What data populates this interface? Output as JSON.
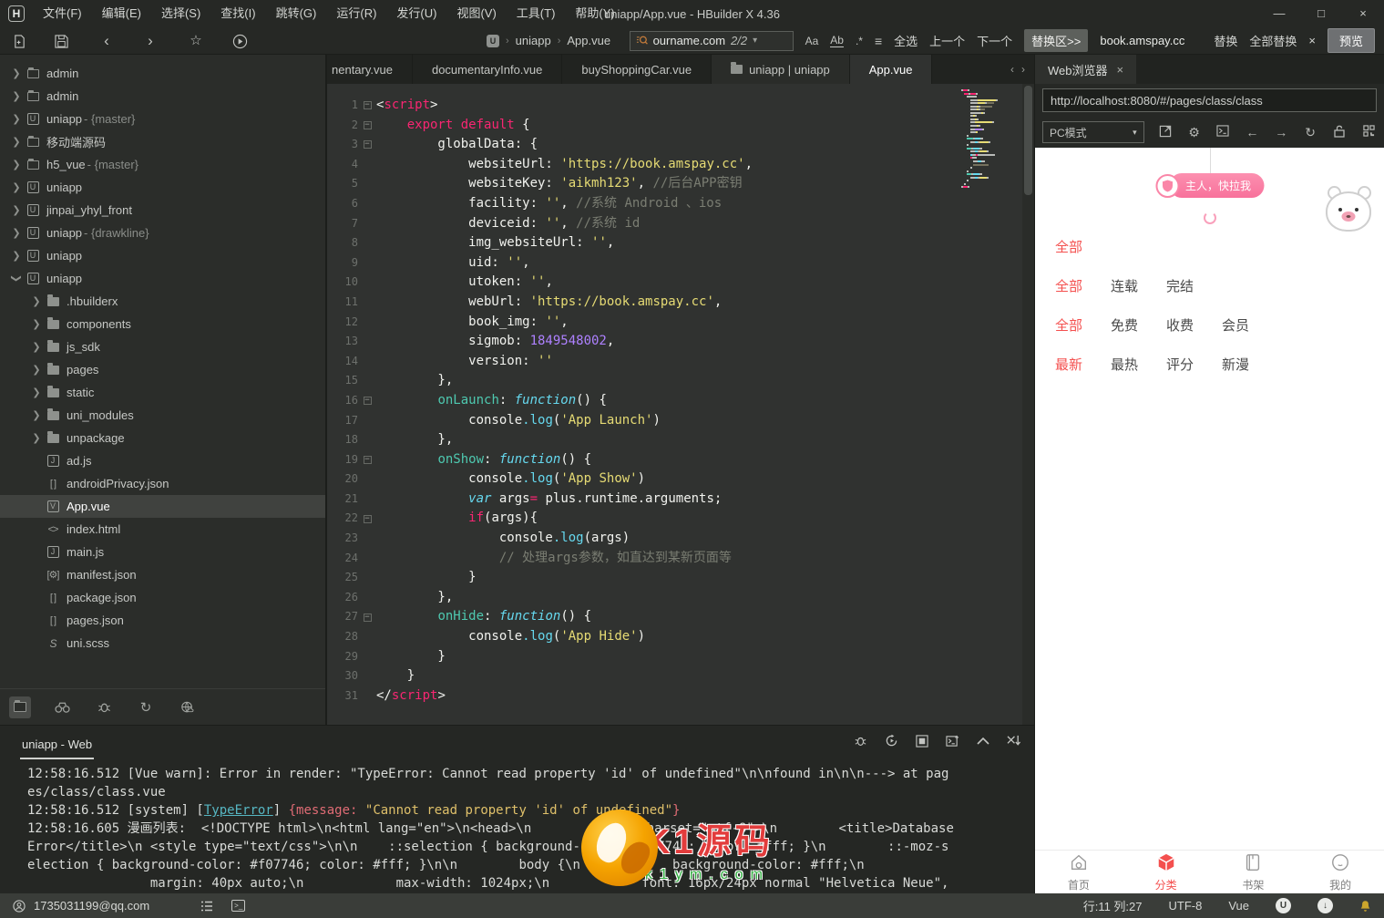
{
  "window": {
    "title": "uniapp/App.vue - HBuilder X 4.36",
    "logo": "H",
    "minimize": "—",
    "maximize": "□",
    "close": "×"
  },
  "menus": [
    "文件(F)",
    "编辑(E)",
    "选择(S)",
    "查找(I)",
    "跳转(G)",
    "运行(R)",
    "发行(U)",
    "视图(V)",
    "工具(T)",
    "帮助(Y)"
  ],
  "toolbar": {
    "crumb_project": "uniapp",
    "crumb_file": "App.vue",
    "search_value": "ourname.com",
    "search_count": "2/2",
    "match_case": "Aa",
    "whole_word": "Ab",
    "regex": ".*",
    "filter_lines": "≡",
    "select_all": "全选",
    "prev": "上一个",
    "next": "下一个",
    "replace_zone": "替换区>>",
    "replace_value": "book.amspay.cc",
    "replace": "替换",
    "replace_all": "全部替换",
    "close": "×",
    "preview": "预览"
  },
  "colors": {
    "accent_pink": "#fa86a8",
    "hot_red": "#f4504f",
    "keyword": "#f92672",
    "string": "#e6db74",
    "number": "#ae81ff",
    "function": "#66d9ef",
    "lifecycle": "#4ec9b0",
    "comment": "#7a7d72",
    "error_link": "#56b6c2",
    "bell_yellow": "#cda62c"
  },
  "sidebar": {
    "items": [
      {
        "arrow": ">",
        "icon": "folder",
        "label": "admin",
        "depth": 0
      },
      {
        "arrow": ">",
        "icon": "folder",
        "label": "admin",
        "depth": 0
      },
      {
        "arrow": ">",
        "icon": "proj",
        "label": "uniapp",
        "suffix": " - {master}",
        "depth": 0
      },
      {
        "arrow": ">",
        "icon": "folder",
        "label": "移动端源码",
        "depth": 0
      },
      {
        "arrow": ">",
        "icon": "folder",
        "label": "h5_vue",
        "suffix": " - {master}",
        "depth": 0
      },
      {
        "arrow": ">",
        "icon": "proj",
        "label": "uniapp",
        "depth": 0
      },
      {
        "arrow": ">",
        "icon": "proj",
        "label": "jinpai_yhyl_front",
        "depth": 0
      },
      {
        "arrow": ">",
        "icon": "proj",
        "label": "uniapp",
        "suffix": " - {drawkline}",
        "depth": 0
      },
      {
        "arrow": ">",
        "icon": "proj",
        "label": "uniapp",
        "depth": 0
      },
      {
        "arrow": "v",
        "icon": "proj",
        "label": "uniapp",
        "depth": 0
      },
      {
        "arrow": ">",
        "icon": "folder2",
        "label": ".hbuilderx",
        "depth": 1
      },
      {
        "arrow": ">",
        "icon": "folder2",
        "label": "components",
        "depth": 1
      },
      {
        "arrow": ">",
        "icon": "folder2",
        "label": "js_sdk",
        "depth": 1
      },
      {
        "arrow": ">",
        "icon": "folder2",
        "label": "pages",
        "depth": 1
      },
      {
        "arrow": ">",
        "icon": "folder2",
        "label": "static",
        "depth": 1
      },
      {
        "arrow": ">",
        "icon": "folder2",
        "label": "uni_modules",
        "depth": 1
      },
      {
        "arrow": ">",
        "icon": "folder2",
        "label": "unpackage",
        "depth": 1
      },
      {
        "icon": "js",
        "label": "ad.js",
        "depth": 1
      },
      {
        "icon": "json",
        "label": "androidPrivacy.json",
        "depth": 1
      },
      {
        "icon": "vue",
        "label": "App.vue",
        "depth": 1,
        "selected": true
      },
      {
        "icon": "html",
        "label": "index.html",
        "depth": 1
      },
      {
        "icon": "js",
        "label": "main.js",
        "depth": 1
      },
      {
        "icon": "manifest",
        "label": "manifest.json",
        "depth": 1
      },
      {
        "icon": "json",
        "label": "package.json",
        "depth": 1
      },
      {
        "icon": "json",
        "label": "pages.json",
        "depth": 1
      },
      {
        "icon": "scss",
        "label": "uni.scss",
        "depth": 1
      }
    ]
  },
  "editor": {
    "tabs": [
      {
        "label": "nentary.vue",
        "first": true
      },
      {
        "label": "documentaryInfo.vue"
      },
      {
        "label": "buyShoppingCar.vue"
      },
      {
        "label": "uniapp | uniapp",
        "icon": "folder",
        "mid": true
      },
      {
        "label": "App.vue",
        "active": true
      }
    ],
    "lines": [
      {
        "n": 1,
        "fold": 1,
        "tok": [
          [
            "pl",
            "<"
          ],
          [
            "kw",
            "script"
          ],
          [
            "pl",
            ">"
          ]
        ]
      },
      {
        "n": 2,
        "fold": 1,
        "tok": [
          [
            "pl",
            "    "
          ],
          [
            "kw",
            "export"
          ],
          [
            "pl",
            " "
          ],
          [
            "kw",
            "default"
          ],
          [
            "pl",
            " {"
          ]
        ]
      },
      {
        "n": 3,
        "fold": 1,
        "tok": [
          [
            "pl",
            "        globalData: {"
          ]
        ]
      },
      {
        "n": 4,
        "tok": [
          [
            "pl",
            "            websiteUrl: "
          ],
          [
            "str",
            "'https://book.amspay.cc'"
          ],
          [
            "pl",
            ","
          ]
        ]
      },
      {
        "n": 5,
        "tok": [
          [
            "pl",
            "            websiteKey: "
          ],
          [
            "str",
            "'aikmh123'"
          ],
          [
            "pl",
            ", "
          ],
          [
            "cmt",
            "//后台APP密钥"
          ]
        ]
      },
      {
        "n": 6,
        "tok": [
          [
            "pl",
            "            facility: "
          ],
          [
            "str",
            "''"
          ],
          [
            "pl",
            ", "
          ],
          [
            "cmt",
            "//系统 Android 、ios"
          ]
        ]
      },
      {
        "n": 7,
        "tok": [
          [
            "pl",
            "            deviceid: "
          ],
          [
            "str",
            "''"
          ],
          [
            "pl",
            ", "
          ],
          [
            "cmt",
            "//系统 id"
          ]
        ]
      },
      {
        "n": 8,
        "tok": [
          [
            "pl",
            "            img_websiteUrl: "
          ],
          [
            "str",
            "''"
          ],
          [
            "pl",
            ","
          ]
        ]
      },
      {
        "n": 9,
        "tok": [
          [
            "pl",
            "            uid: "
          ],
          [
            "str",
            "''"
          ],
          [
            "pl",
            ","
          ]
        ]
      },
      {
        "n": 10,
        "tok": [
          [
            "pl",
            "            utoken: "
          ],
          [
            "str",
            "''"
          ],
          [
            "pl",
            ","
          ]
        ]
      },
      {
        "n": 11,
        "tok": [
          [
            "pl",
            "            webUrl: "
          ],
          [
            "str",
            "'https://book.amspay.cc'"
          ],
          [
            "pl",
            ","
          ]
        ]
      },
      {
        "n": 12,
        "tok": [
          [
            "pl",
            "            book_img: "
          ],
          [
            "str",
            "''"
          ],
          [
            "pl",
            ","
          ]
        ]
      },
      {
        "n": 13,
        "tok": [
          [
            "pl",
            "            sigmob: "
          ],
          [
            "num",
            "1849548002"
          ],
          [
            "pl",
            ","
          ]
        ]
      },
      {
        "n": 14,
        "tok": [
          [
            "pl",
            "            version: "
          ],
          [
            "str",
            "''"
          ]
        ]
      },
      {
        "n": 15,
        "tok": [
          [
            "pl",
            "        },"
          ]
        ]
      },
      {
        "n": 16,
        "fold": 1,
        "tok": [
          [
            "pl",
            "        "
          ],
          [
            "name",
            "onLaunch"
          ],
          [
            "pl",
            ": "
          ],
          [
            "fn",
            "function"
          ],
          [
            "pl",
            "() {"
          ]
        ]
      },
      {
        "n": 17,
        "tok": [
          [
            "pl",
            "            console"
          ],
          [
            "meth",
            ".log"
          ],
          [
            "pl",
            "("
          ],
          [
            "str",
            "'App Launch'"
          ],
          [
            "pl",
            ")"
          ]
        ]
      },
      {
        "n": 18,
        "tok": [
          [
            "pl",
            "        },"
          ]
        ]
      },
      {
        "n": 19,
        "fold": 1,
        "tok": [
          [
            "pl",
            "        "
          ],
          [
            "name",
            "onShow"
          ],
          [
            "pl",
            ": "
          ],
          [
            "fn",
            "function"
          ],
          [
            "pl",
            "() {"
          ]
        ]
      },
      {
        "n": 20,
        "tok": [
          [
            "pl",
            "            console"
          ],
          [
            "meth",
            ".log"
          ],
          [
            "pl",
            "("
          ],
          [
            "str",
            "'App Show'"
          ],
          [
            "pl",
            ")"
          ]
        ]
      },
      {
        "n": 21,
        "tok": [
          [
            "pl",
            "            "
          ],
          [
            "fn",
            "var"
          ],
          [
            "pl",
            " args"
          ],
          [
            "kw",
            "="
          ],
          [
            "pl",
            " plus.runtime.arguments;"
          ]
        ]
      },
      {
        "n": 22,
        "fold": 1,
        "tok": [
          [
            "pl",
            "            "
          ],
          [
            "kw",
            "if"
          ],
          [
            "pl",
            "(args){"
          ]
        ]
      },
      {
        "n": 23,
        "tok": [
          [
            "pl",
            "                console"
          ],
          [
            "meth",
            ".log"
          ],
          [
            "pl",
            "(args)"
          ]
        ]
      },
      {
        "n": 24,
        "tok": [
          [
            "pl",
            "                "
          ],
          [
            "cmt",
            "// 处理args参数，如直达到某新页面等"
          ]
        ]
      },
      {
        "n": 25,
        "tok": [
          [
            "pl",
            "            }"
          ]
        ]
      },
      {
        "n": 26,
        "tok": [
          [
            "pl",
            "        },"
          ]
        ]
      },
      {
        "n": 27,
        "fold": 1,
        "tok": [
          [
            "pl",
            "        "
          ],
          [
            "name",
            "onHide"
          ],
          [
            "pl",
            ": "
          ],
          [
            "fn",
            "function"
          ],
          [
            "pl",
            "() {"
          ]
        ]
      },
      {
        "n": 28,
        "tok": [
          [
            "pl",
            "            console"
          ],
          [
            "meth",
            ".log"
          ],
          [
            "pl",
            "("
          ],
          [
            "str",
            "'App Hide'"
          ],
          [
            "pl",
            ")"
          ]
        ]
      },
      {
        "n": 29,
        "tok": [
          [
            "pl",
            "        }"
          ]
        ]
      },
      {
        "n": 30,
        "tok": [
          [
            "pl",
            "    }"
          ]
        ]
      },
      {
        "n": 31,
        "tok": [
          [
            "pl",
            "</"
          ],
          [
            "kw",
            "script"
          ],
          [
            "pl",
            ">"
          ]
        ]
      }
    ]
  },
  "browser": {
    "tab_label": "Web浏览器",
    "close": "×",
    "url": "http://localhost:8080/#/pages/class/class",
    "mode": "PC模式",
    "banner": "主人，快拉我",
    "filters": [
      [
        "全部"
      ],
      [
        "全部",
        "连载",
        "完结"
      ],
      [
        "全部",
        "免费",
        "收费",
        "会员"
      ],
      [
        "最新",
        "最热",
        "评分",
        "新漫"
      ]
    ],
    "tabbar": [
      {
        "label": "首页",
        "icon": "home"
      },
      {
        "label": "分类",
        "icon": "cube",
        "active": true
      },
      {
        "label": "书架",
        "icon": "book"
      },
      {
        "label": "我的",
        "icon": "user"
      }
    ]
  },
  "console": {
    "tab": "uniapp - Web",
    "lines": [
      [
        [
          "p",
          "12:58:16.512 [Vue warn]: Error in render: \"TypeError: Cannot read property 'id' of undefined\"\\n\\nfound in\\n\\n---> at pag"
        ]
      ],
      [
        [
          "p",
          "es/class/class.vue"
        ]
      ],
      [
        [
          "p",
          "12:58:16.512 [system] ["
        ],
        [
          "link",
          "TypeError"
        ],
        [
          "p",
          "] "
        ],
        [
          "red",
          "{message: "
        ],
        [
          "yel",
          "\"Cannot read property 'id' of undefined\""
        ],
        [
          "red",
          "}"
        ]
      ],
      [
        [
          "p",
          "12:58:16.605 漫画列表:  <!DOCTYPE html>\\n<html lang=\"en\">\\n<head>\\n        <meta charset=\"utf-8\">\\n        <title>Database"
        ]
      ],
      [
        [
          "p",
          "Error</title>\\n <style type=\"text/css\">\\n\\n    ::selection { background-color: #f07746; color: #fff; }\\n        ::-moz-s"
        ]
      ],
      [
        [
          "p",
          "election { background-color: #f07746; color: #fff; }\\n\\n        body {\\n            background-color: #fff;\\n"
        ]
      ],
      [
        [
          "p",
          "                margin: 40px auto;\\n            max-width: 1024px;\\n            font: 16px/24px normal \"Helvetica Neue\","
        ]
      ]
    ]
  },
  "watermark": {
    "title": "K1源码",
    "domain": "k1ym.com"
  },
  "statusbar": {
    "user": "1735031199@qq.com",
    "line_col": "行:11 列:27",
    "encoding": "UTF-8",
    "syntax": "Vue"
  }
}
